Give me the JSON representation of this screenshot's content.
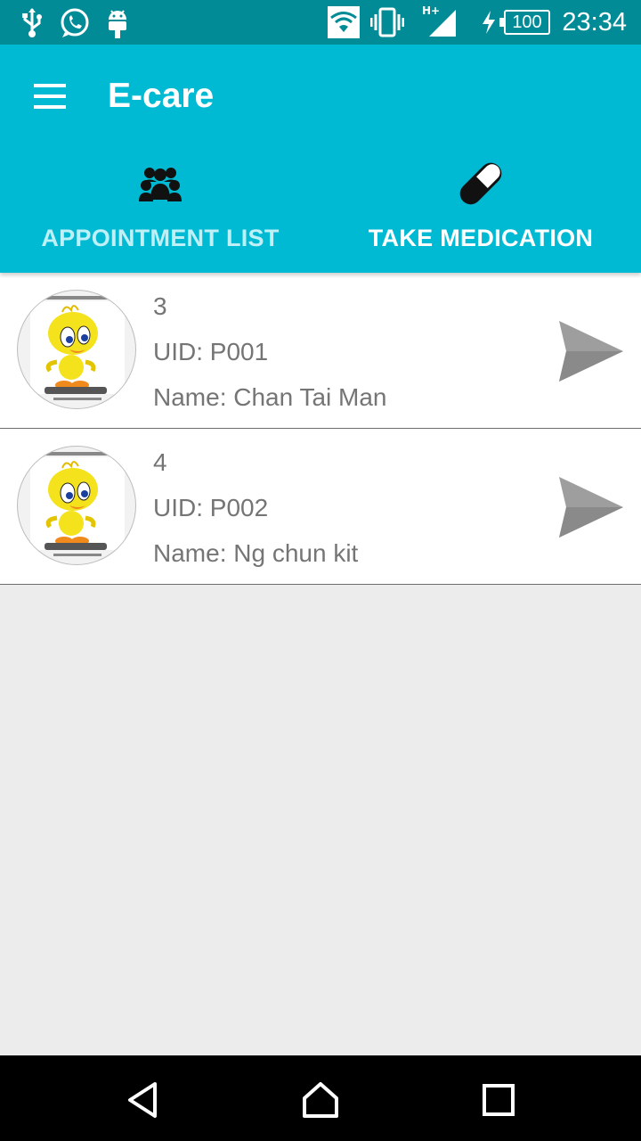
{
  "status_bar": {
    "time": "23:34",
    "battery": "100",
    "network": "H+",
    "icons": [
      "usb-icon",
      "whatsapp-icon",
      "android-debug-icon",
      "wifi-icon",
      "vibrate-icon",
      "signal-icon",
      "charging-icon"
    ]
  },
  "app_bar": {
    "title": "E-care",
    "menu_icon": "hamburger-menu-icon",
    "color": "#00bad3"
  },
  "tabs": [
    {
      "label": "APPOINTMENT LIST",
      "icon": "group-icon",
      "selected": false
    },
    {
      "label": "TAKE MEDICATION",
      "icon": "pill-icon",
      "selected": true
    }
  ],
  "patients": [
    {
      "number": "3",
      "uid": "UID: P001",
      "name": "Name: Chan Tai Man"
    },
    {
      "number": "4",
      "uid": "UID: P002",
      "name": "Name: Ng chun kit"
    }
  ],
  "nav_bar": {
    "icons": [
      "back-icon",
      "home-icon",
      "recents-icon"
    ]
  }
}
